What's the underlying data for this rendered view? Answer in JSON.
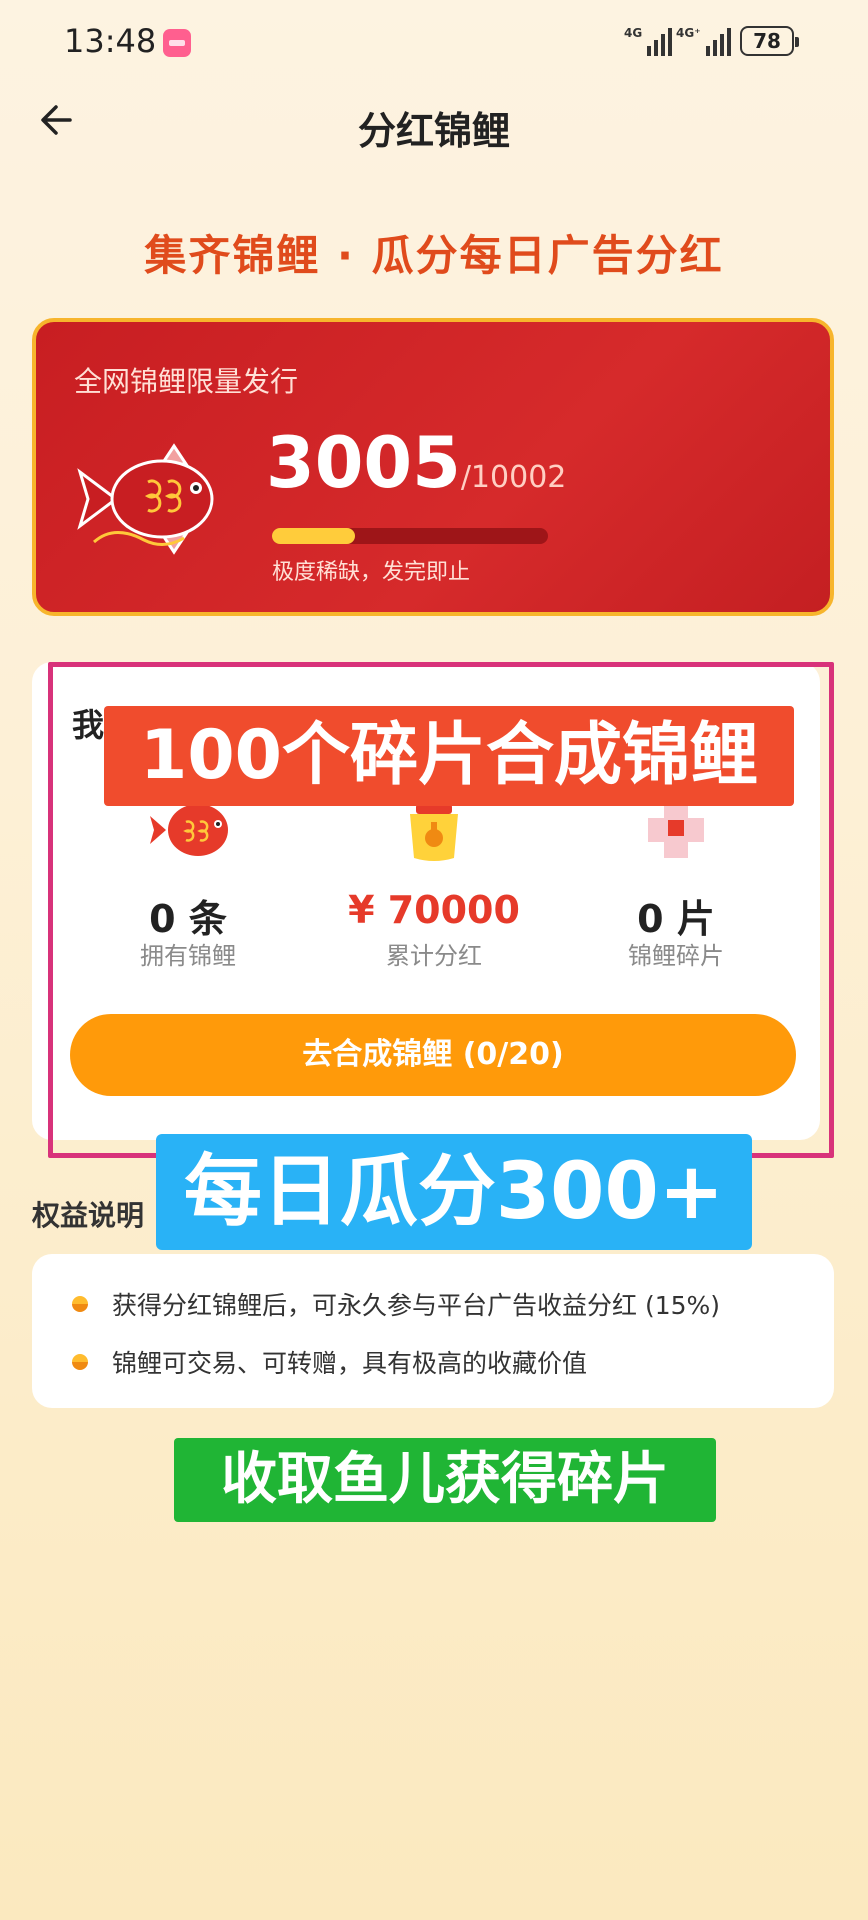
{
  "status_bar": {
    "time": "13:48",
    "signal1": "4G",
    "signal2": "4G⁺",
    "battery": "78"
  },
  "header": {
    "title": "分红锦鲤"
  },
  "headline": "集齐锦鲤 · 瓜分每日广告分红",
  "supply_card": {
    "label": "全网锦鲤限量发行",
    "issued": "3005",
    "total": "/10002",
    "progress_fraction": 0.3,
    "note": "极度稀缺，发完即止"
  },
  "my_card": {
    "title": "我的分红收益",
    "stats": [
      {
        "value": "0 条",
        "label": "拥有锦鲤"
      },
      {
        "value": "¥ 70000",
        "label": "累计分红"
      },
      {
        "value": "0 片",
        "label": "锦鲤碎片"
      }
    ],
    "button": "去合成锦鲤 (0/20)"
  },
  "overlays": {
    "red": "100个碎片合成锦鲤",
    "blue": "每日瓜分300+",
    "green": "收取鱼儿获得碎片"
  },
  "benefits": {
    "title": "权益说明",
    "items": [
      "获得分红锦鲤后，可永久参与平台广告收益分红 (15%)",
      "锦鲤可交易、可转赠，具有极高的收藏价值"
    ]
  },
  "colors": {
    "accent": "#e04b1c",
    "card_red": "#d62a2b",
    "button": "#ff9a0a",
    "frame": "#d8327a"
  }
}
